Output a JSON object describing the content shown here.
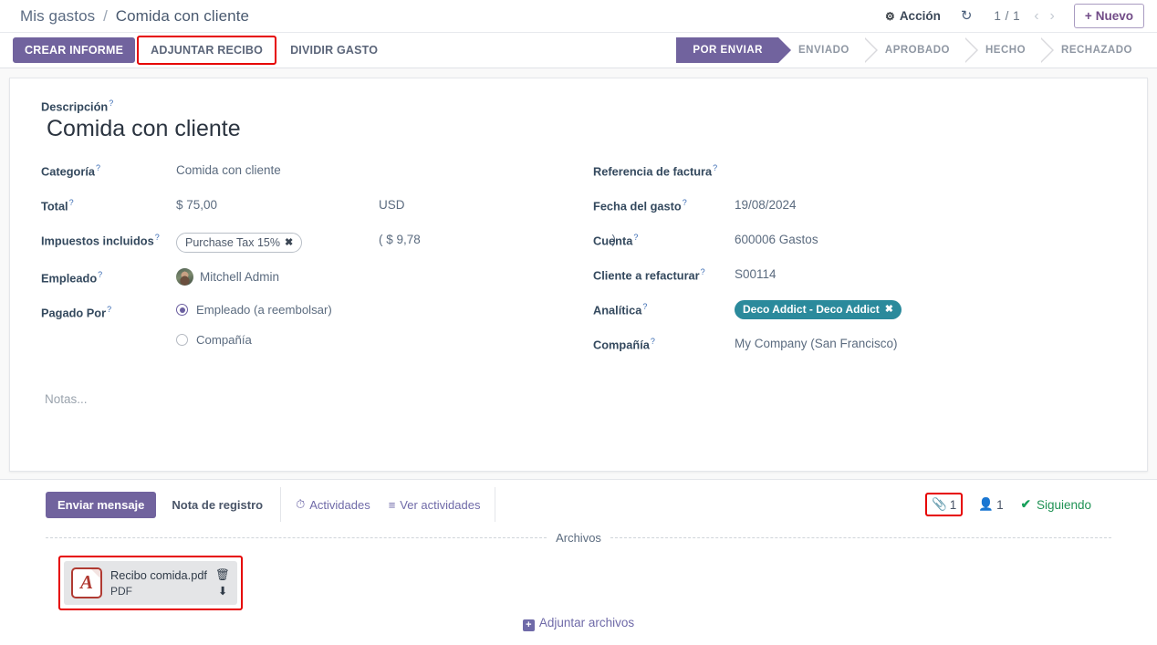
{
  "breadcrumb": {
    "root": "Mis gastos",
    "separator": "/",
    "current": "Comida con cliente"
  },
  "topbar": {
    "action_label": "Acción",
    "gear_icon": "gear-icon",
    "refresh_icon": "refresh-icon",
    "pager_count": "1 / 1",
    "prev_icon": "chevron-left-icon",
    "next_icon": "chevron-right-icon",
    "new_label": "Nuevo",
    "new_plus": "+"
  },
  "controlpanel": {
    "buttons": [
      {
        "label": "CREAR INFORME",
        "style": "primary",
        "highlighted": false
      },
      {
        "label": "ADJUNTAR RECIBO",
        "style": "flat",
        "highlighted": true
      },
      {
        "label": "DIVIDIR GASTO",
        "style": "flat",
        "highlighted": false
      }
    ],
    "statusbar": [
      {
        "label": "POR ENVIAR",
        "active": true
      },
      {
        "label": "ENVIADO",
        "active": false
      },
      {
        "label": "APROBADO",
        "active": false
      },
      {
        "label": "HECHO",
        "active": false
      },
      {
        "label": "RECHAZADO",
        "active": false
      }
    ]
  },
  "form": {
    "description_label": "Descripción",
    "description_value": "Comida con cliente",
    "help_marker": "?",
    "left": {
      "categoria_label": "Categoría",
      "categoria_value": "Comida con cliente",
      "total_label": "Total",
      "total_value": "$ 75,00",
      "currency": "USD",
      "impuestos_label": "Impuestos incluidos",
      "tax_tag": "Purchase Tax 15%",
      "tax_tag_remove": "✖",
      "tax_amount_open": "( $ 9,78",
      "tax_amount_close": ")",
      "empleado_label": "Empleado",
      "empleado_value": "Mitchell Admin",
      "pagado_label": "Pagado Por",
      "pagado_options": [
        {
          "label": "Empleado (a reembolsar)",
          "selected": true
        },
        {
          "label": "Compañía",
          "selected": false
        }
      ]
    },
    "right": {
      "referencia_label": "Referencia de factura",
      "referencia_value": "",
      "fecha_label": "Fecha del gasto",
      "fecha_value": "19/08/2024",
      "cuenta_label": "Cuenta",
      "cuenta_value": "600006 Gastos",
      "cliente_label": "Cliente a refacturar",
      "cliente_value": "S00114",
      "analitica_label": "Analítica",
      "analitica_tag": "Deco Addict - Deco Addict",
      "analitica_tag_remove": "✖",
      "compania_label": "Compañía",
      "compania_value": "My Company (San Francisco)"
    },
    "notes_placeholder": "Notas..."
  },
  "chatter": {
    "send_message": "Enviar mensaje",
    "log_note": "Nota de registro",
    "activities_label": "Actividades",
    "activities_icon": "clock-icon",
    "view_activities_label": "Ver actividades",
    "view_activities_icon": "list-icon",
    "attachment_icon": "paperclip-icon",
    "attachment_count": "1",
    "followers_icon": "user-icon",
    "followers_count": "1",
    "following_label": "Siguiendo",
    "following_icon": "check-icon",
    "files_caption": "Archivos",
    "attachments": [
      {
        "name": "Recibo comida.pdf",
        "type": "PDF",
        "glyph": "A",
        "delete_icon": "trash-icon",
        "download_icon": "download-icon",
        "highlighted": true
      }
    ],
    "attach_files_label": "Adjuntar archivos",
    "attach_files_icon": "plus-square-icon"
  },
  "colors": {
    "accent_purple": "#71639e",
    "tag_teal": "#2b8a9c",
    "highlight_red": "#e60000",
    "following_green": "#1f9254",
    "pdf_red": "#b03a32"
  }
}
